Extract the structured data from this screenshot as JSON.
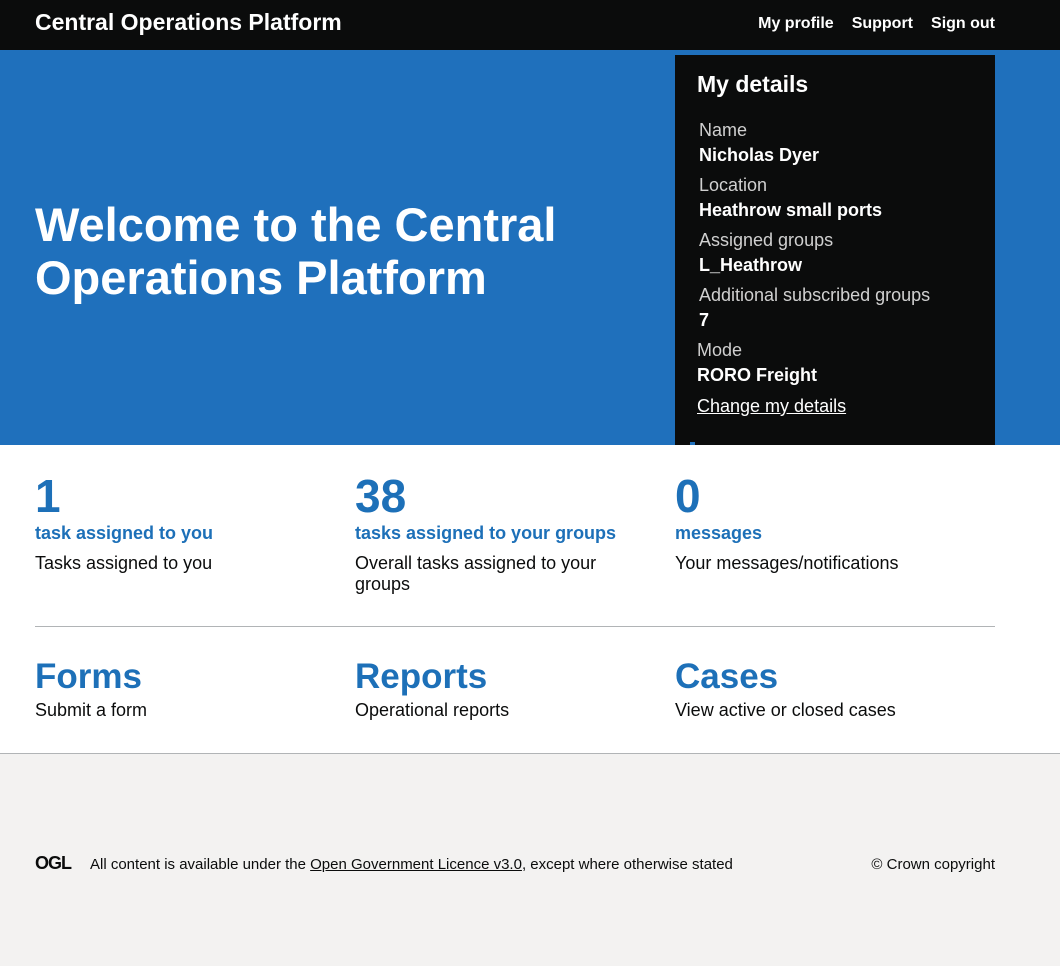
{
  "header": {
    "title": "Central Operations Platform",
    "nav": [
      {
        "label": "My profile"
      },
      {
        "label": "Support"
      },
      {
        "label": "Sign out"
      }
    ]
  },
  "hero": {
    "heading": "Welcome to the Central Operations Platform"
  },
  "my_details": {
    "heading": "My details",
    "fields": [
      {
        "label": "Name",
        "value": "Nicholas Dyer"
      },
      {
        "label": "Location",
        "value": "Heathrow small ports"
      },
      {
        "label": "Assigned groups",
        "value": "L_Heathrow"
      },
      {
        "label": "Additional subscribed groups",
        "value": "7"
      },
      {
        "label": "Mode",
        "value": "RORO Freight"
      }
    ],
    "change_link": "Change my details"
  },
  "stats": [
    {
      "count": "1",
      "title": "task assigned to you",
      "description": "Tasks assigned to you"
    },
    {
      "count": "38",
      "title": "tasks assigned to your groups",
      "description": "Overall tasks assigned to your groups"
    },
    {
      "count": "0",
      "title": "messages",
      "description": "Your messages/notifications"
    }
  ],
  "sections": [
    {
      "title": "Forms",
      "description": "Submit a form"
    },
    {
      "title": "Reports",
      "description": "Operational reports"
    },
    {
      "title": "Cases",
      "description": "View active or closed cases"
    }
  ],
  "footer": {
    "logo_text": "OGL",
    "licence_prefix": "All content is available under the ",
    "licence_link": "Open Government Licence v3.0",
    "licence_suffix": ", except where otherwise stated",
    "copyright": "© Crown copyright"
  },
  "colors": {
    "header_bg": "#0b0c0c",
    "hero_bg": "#1f70bc",
    "link_blue": "#1d70b8",
    "footer_bg": "#f3f2f1"
  }
}
